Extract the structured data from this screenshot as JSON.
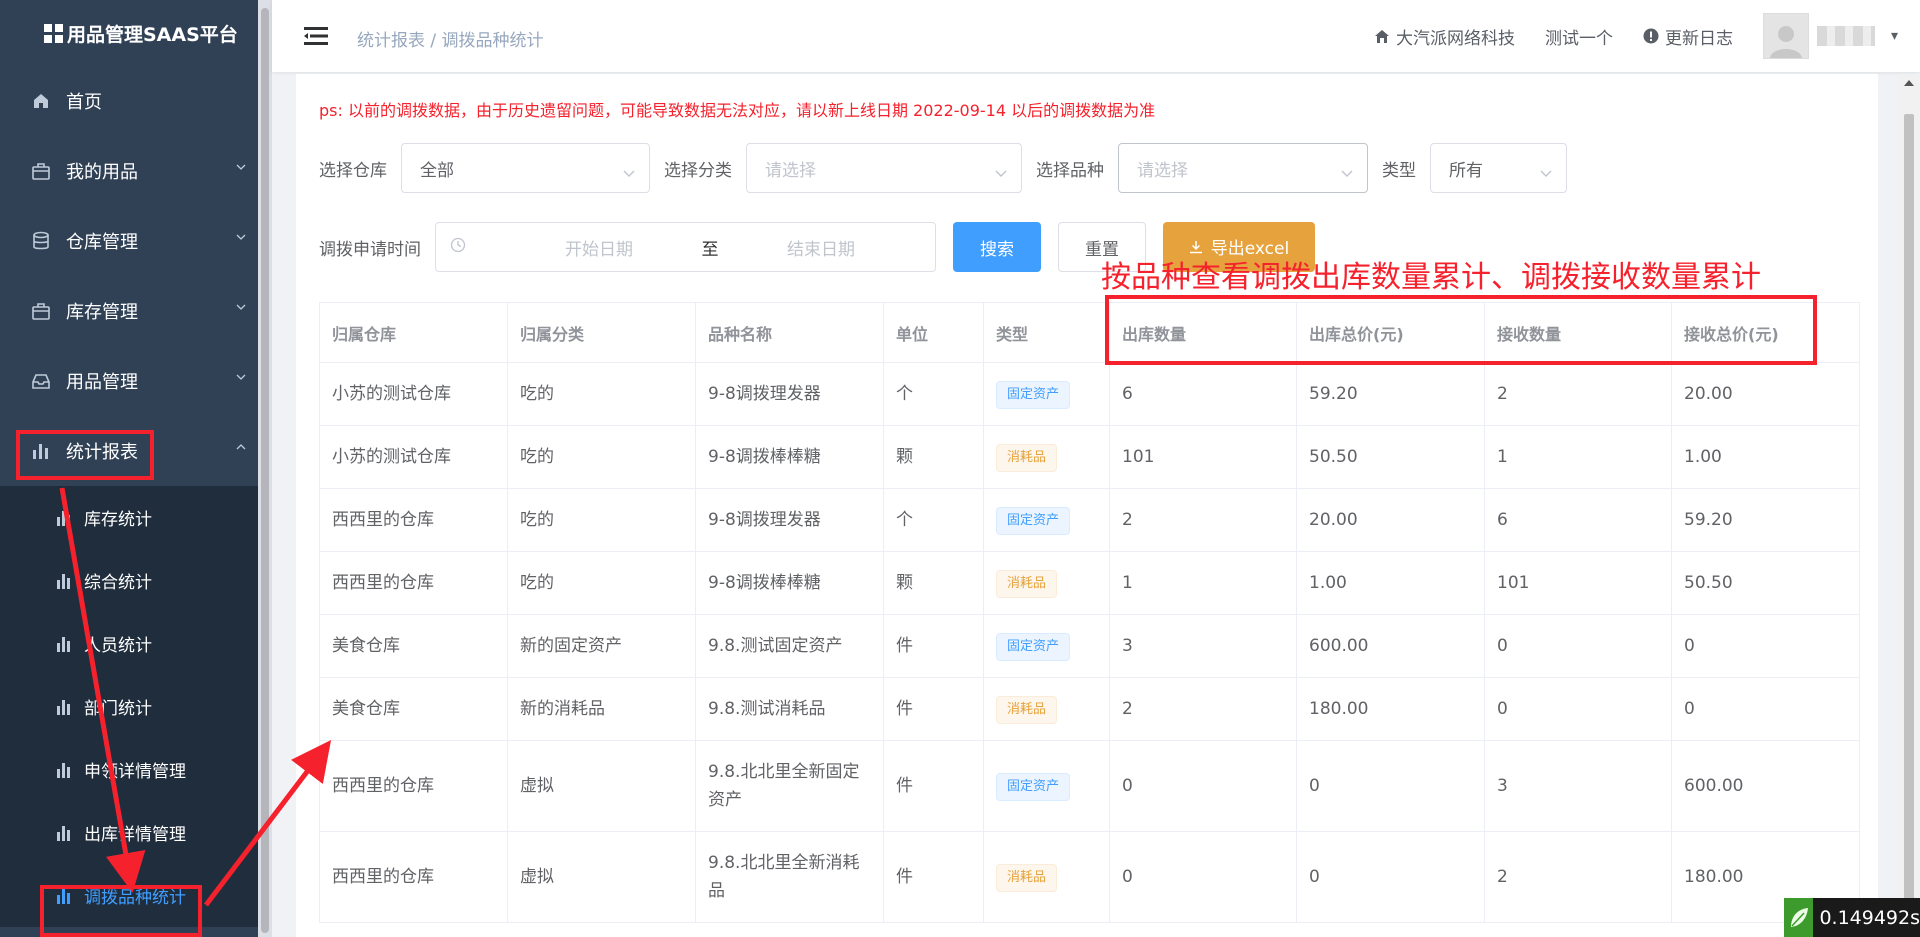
{
  "app": {
    "title": "用品管理SAAS平台"
  },
  "sidebar": {
    "items": [
      {
        "label": "首页",
        "icon": "home-icon",
        "has_arrow": false
      },
      {
        "label": "我的用品",
        "icon": "package-icon",
        "has_arrow": true
      },
      {
        "label": "仓库管理",
        "icon": "database-icon",
        "has_arrow": true
      },
      {
        "label": "库存管理",
        "icon": "package-icon",
        "has_arrow": true
      },
      {
        "label": "用品管理",
        "icon": "inbox-icon",
        "has_arrow": true
      },
      {
        "label": "统计报表",
        "icon": "bar-chart-icon",
        "has_arrow": true,
        "expanded": true
      }
    ],
    "sub_items": [
      {
        "label": "库存统计"
      },
      {
        "label": "综合统计"
      },
      {
        "label": "人员统计"
      },
      {
        "label": "部门统计"
      },
      {
        "label": "申领详情管理"
      },
      {
        "label": "出库详情管理"
      },
      {
        "label": "调拨品种统计",
        "active": true
      }
    ]
  },
  "navbar": {
    "breadcrumb_parent": "统计报表",
    "breadcrumb_sep": "/",
    "breadcrumb_current": "调拨品种统计",
    "company": "大汽派网络科技",
    "test": "测试一个",
    "changelog": "更新日志"
  },
  "notice": "ps: 以前的调拨数据，由于历史遗留问题，可能导致数据无法对应，请以新上线日期 2022-09-14 以后的调拨数据为准",
  "filters": {
    "warehouse_label": "选择仓库",
    "warehouse_value": "全部",
    "category_label": "选择分类",
    "category_placeholder": "请选择",
    "variety_label": "选择品种",
    "variety_placeholder": "请选择",
    "type_label": "类型",
    "type_value": "所有",
    "date_label": "调拨申请时间",
    "date_start_placeholder": "开始日期",
    "date_sep": "至",
    "date_end_placeholder": "结束日期",
    "search_btn": "搜索",
    "reset_btn": "重置",
    "export_btn": "导出excel"
  },
  "annotation": "按品种查看调拨出库数量累计、调拨接收数量累计",
  "table": {
    "headers": [
      "归属仓库",
      "归属分类",
      "品种名称",
      "单位",
      "类型",
      "出库数量",
      "出库总价(元)",
      "接收数量",
      "接收总价(元)"
    ],
    "rows": [
      [
        "小苏的测试仓库",
        "吃的",
        "9-8调拨理发器",
        "个",
        "固定资产",
        "6",
        "59.20",
        "2",
        "20.00"
      ],
      [
        "小苏的测试仓库",
        "吃的",
        "9-8调拨棒棒糖",
        "颗",
        "消耗品",
        "101",
        "50.50",
        "1",
        "1.00"
      ],
      [
        "西西里的仓库",
        "吃的",
        "9-8调拨理发器",
        "个",
        "固定资产",
        "2",
        "20.00",
        "6",
        "59.20"
      ],
      [
        "西西里的仓库",
        "吃的",
        "9-8调拨棒棒糖",
        "颗",
        "消耗品",
        "1",
        "1.00",
        "101",
        "50.50"
      ],
      [
        "美食仓库",
        "新的固定资产",
        "9.8.测试固定资产",
        "件",
        "固定资产",
        "3",
        "600.00",
        "0",
        "0"
      ],
      [
        "美食仓库",
        "新的消耗品",
        "9.8.测试消耗品",
        "件",
        "消耗品",
        "2",
        "180.00",
        "0",
        "0"
      ],
      [
        "西西里的仓库",
        "虚拟",
        "9.8.北北里全新固定资产",
        "件",
        "固定资产",
        "0",
        "0",
        "3",
        "600.00"
      ],
      [
        "西西里的仓库",
        "虚拟",
        "9.8.北北里全新消耗品",
        "件",
        "消耗品",
        "0",
        "0",
        "2",
        "180.00"
      ]
    ]
  },
  "timer": "0.149492s",
  "colors": {
    "sidebar_bg": "#304156",
    "accent": "#409eff",
    "warning": "#e6a23c",
    "annotation_red": "#f5222d"
  }
}
